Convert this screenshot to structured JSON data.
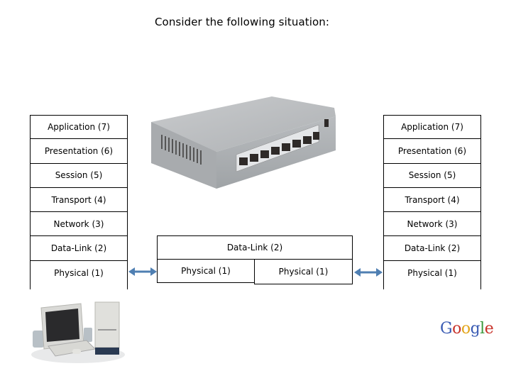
{
  "title": "Consider the following situation:",
  "left_stack": {
    "layers": [
      "Application (7)",
      "Presentation (6)",
      "Session (5)",
      "Transport (4)",
      "Network (3)",
      "Data-Link (2)",
      "Physical (1)"
    ]
  },
  "right_stack": {
    "layers": [
      "Application (7)",
      "Presentation (6)",
      "Session (5)",
      "Transport (4)",
      "Network (3)",
      "Data-Link (2)",
      "Physical (1)"
    ]
  },
  "switch_stack": {
    "data_link": "Data-Link (2)",
    "physical_left": "Physical (1)",
    "physical_right": "Physical (1)"
  },
  "images": {
    "switch": "network-switch-8-port",
    "computer": "desktop-computer",
    "logo": "google-logo"
  },
  "logo": {
    "letters": [
      "G",
      "o",
      "o",
      "g",
      "l",
      "e"
    ],
    "colors": [
      "#3a5bb3",
      "#c8322a",
      "#e3a51b",
      "#3a5bb3",
      "#3c9a3e",
      "#c8322a"
    ]
  },
  "colors": {
    "arrow": "#4f7fb2",
    "border": "#000000"
  }
}
